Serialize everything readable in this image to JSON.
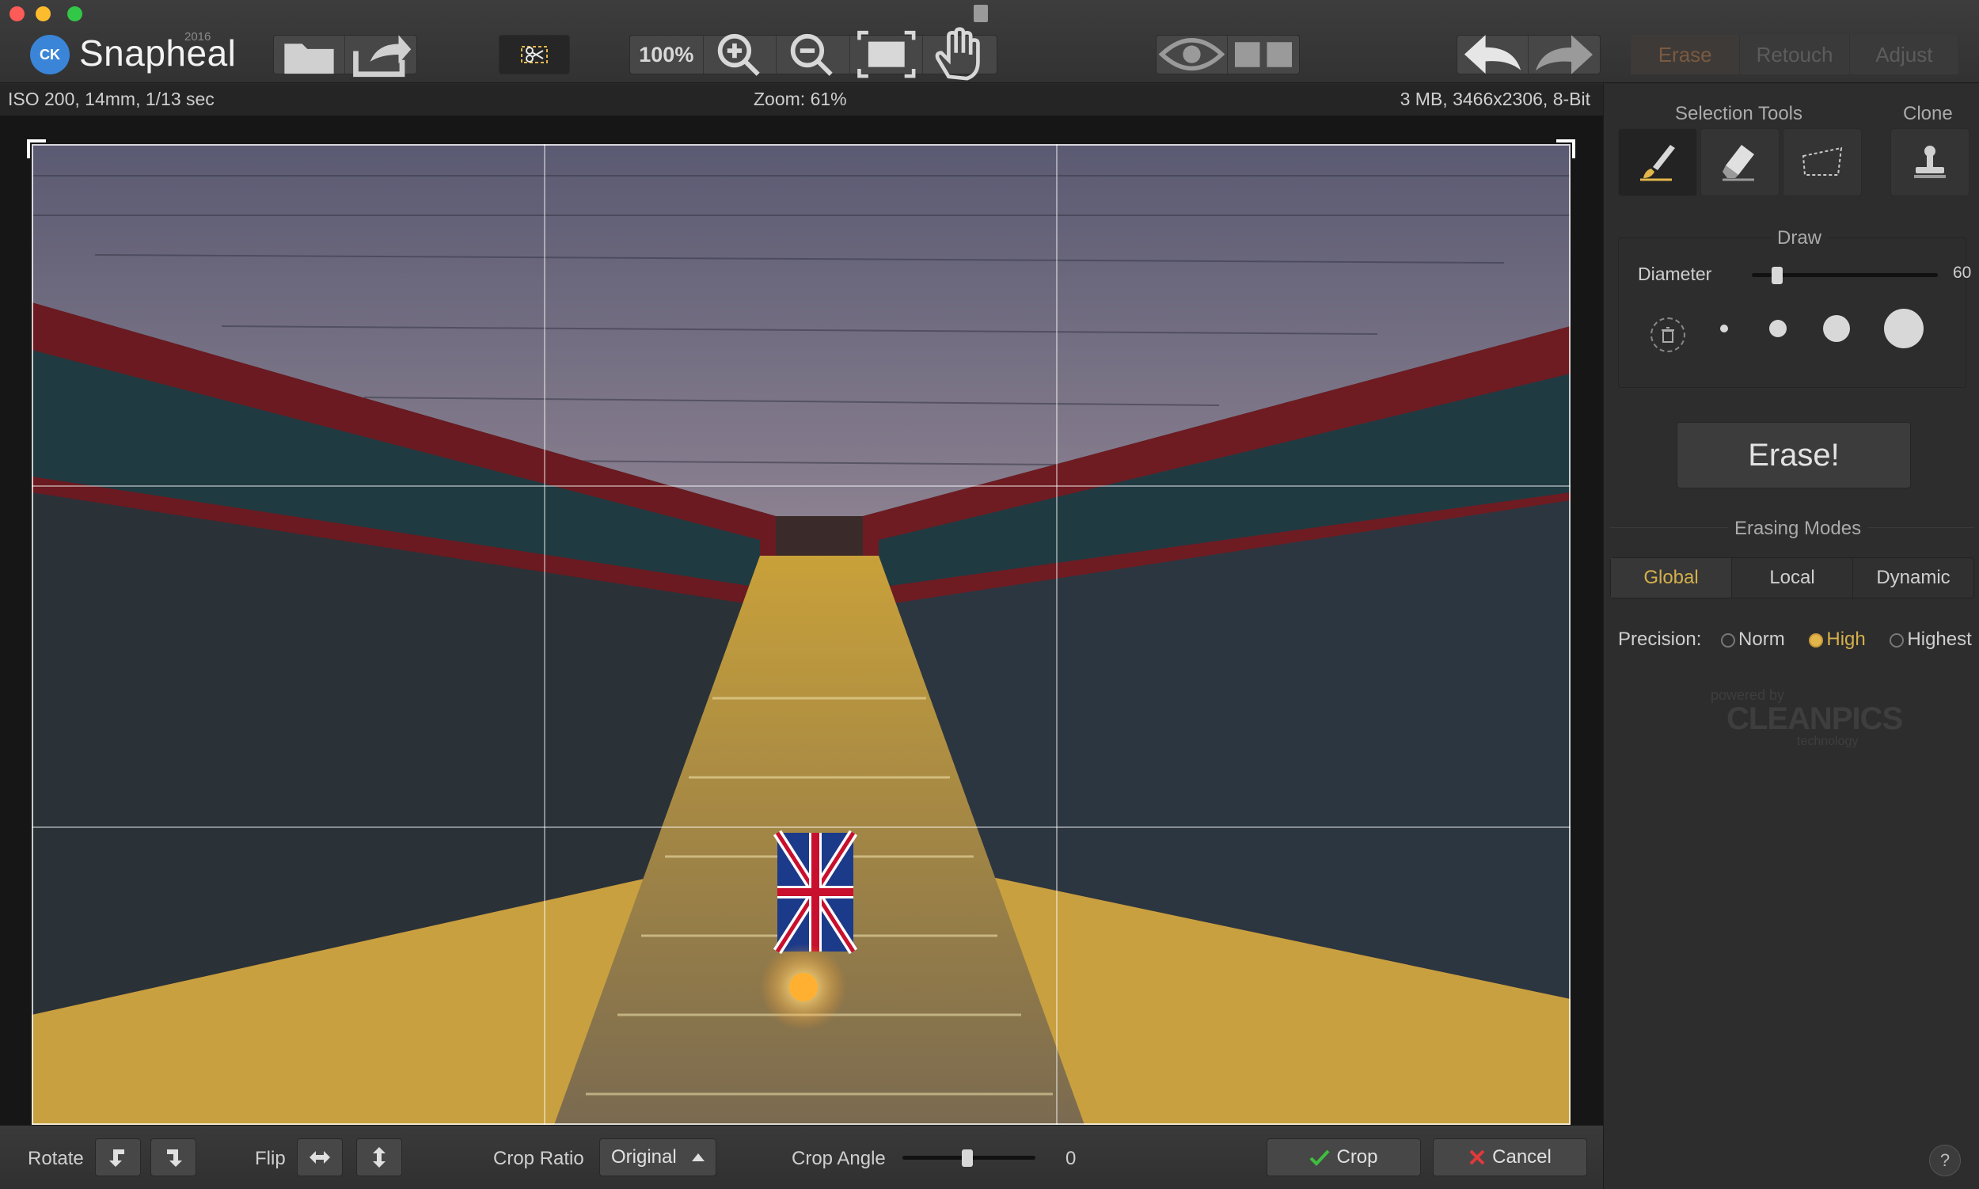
{
  "app": {
    "name": "Snapheal",
    "year": "2016",
    "logo_text": "CK"
  },
  "toolbar": {
    "zoom_button": "100%",
    "icons": [
      "open-folder-icon",
      "share-icon",
      "crop-tool-icon",
      "zoom-in-icon",
      "zoom-out-icon",
      "fit-screen-icon",
      "hand-icon",
      "eye-icon",
      "compare-icon",
      "undo-icon",
      "redo-icon"
    ],
    "tabs": [
      {
        "label": "Erase"
      },
      {
        "label": "Retouch"
      },
      {
        "label": "Adjust"
      }
    ]
  },
  "info": {
    "exif": "ISO 200, 14mm, 1/13 sec",
    "zoom": "Zoom: 61%",
    "file": "3 MB, 3466x2306, 8-Bit"
  },
  "bottom": {
    "rotate_label": "Rotate",
    "flip_label": "Flip",
    "crop_ratio_label": "Crop Ratio",
    "crop_ratio_value": "Original",
    "crop_angle_label": "Crop Angle",
    "crop_angle_value": "0",
    "crop_button": "Crop",
    "cancel_button": "Cancel"
  },
  "sidebar": {
    "selection_tools_title": "Selection Tools",
    "clone_title": "Clone",
    "draw_title": "Draw",
    "diameter_label": "Diameter",
    "diameter_value": "60",
    "erase_button": "Erase!",
    "erasing_modes_title": "Erasing Modes",
    "modes": [
      {
        "label": "Global"
      },
      {
        "label": "Local"
      },
      {
        "label": "Dynamic"
      }
    ],
    "precision_label": "Precision:",
    "precision_options": [
      {
        "label": "Norm"
      },
      {
        "label": "High"
      },
      {
        "label": "Highest"
      }
    ],
    "precision_selected": "High",
    "powered_by": "powered by",
    "brand": "CLEANPICS",
    "brand_sub": "technology"
  },
  "help": "?",
  "colors": {
    "accent": "#d4b04c",
    "crop_check": "#3fbf3f",
    "cancel_x": "#e03a3a"
  }
}
